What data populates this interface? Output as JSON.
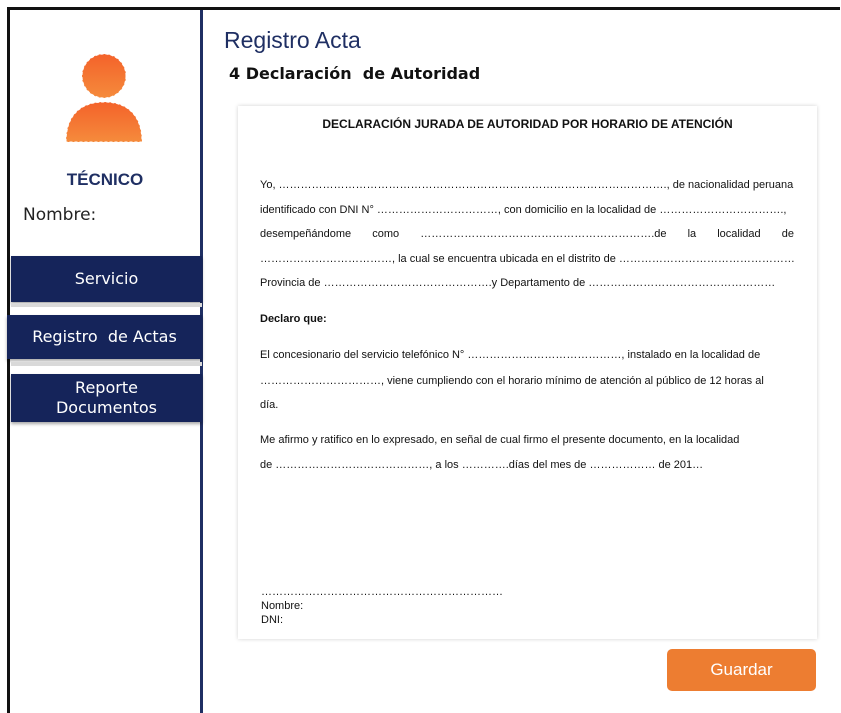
{
  "sidebar": {
    "role_label": "TÉCNICO",
    "name_label": "Nombre:",
    "nav": {
      "servicio": "Servicio",
      "registro_actas": "Registro  de Actas",
      "reporte_line1": "Reporte",
      "reporte_line2": "Documentos"
    }
  },
  "header": {
    "title": "Registro Acta",
    "subtitle": "4 Declaración  de Autoridad"
  },
  "document": {
    "heading": "DECLARACIÓN JURADA DE AUTORIDAD POR HORARIO DE ATENCIÓN",
    "p1_l1": "Yo, ……………………………………………………………………………………………., de nacionalidad peruana,",
    "p1_l2": "identificado con DNI N° ……………………………, con domicilio en la localidad de …………………………….,",
    "p1_l3_a": "desempeñándome",
    "p1_l3_b": "como",
    "p1_l3_c": "……………………………………………………….de",
    "p1_l3_d": "la",
    "p1_l3_e": "localidad",
    "p1_l3_f": "de",
    "p1_l4": "………………………………, la cual se encuentra ubicada en el distrito de …………………………………………,",
    "p1_l5": "Provincia de ……………………………………….y Departamento de ……………………………………………",
    "declaro": "Declaro que:",
    "p2_l1": "El concesionario del servicio telefónico N° ……………………………………, instalado en la localidad de",
    "p2_l2": "……………………………, viene cumpliendo con el horario mínimo de atención al público de 12 horas al",
    "p2_l3": "día.",
    "p3_l1": "Me afirmo y ratifico en lo expresado, en señal de cual firmo el presente documento, en la localidad",
    "p3_l2": "de ……………………………………, a los ………….días del mes de ……………… de 201…",
    "sig_line": "…………………………………………………………",
    "sig_nombre": "Nombre:",
    "sig_dni": "DNI:"
  },
  "actions": {
    "save_label": "Guardar"
  },
  "colors": {
    "accent": "#ed7d31",
    "nav_bg": "#15245a",
    "title": "#1f2f63"
  }
}
